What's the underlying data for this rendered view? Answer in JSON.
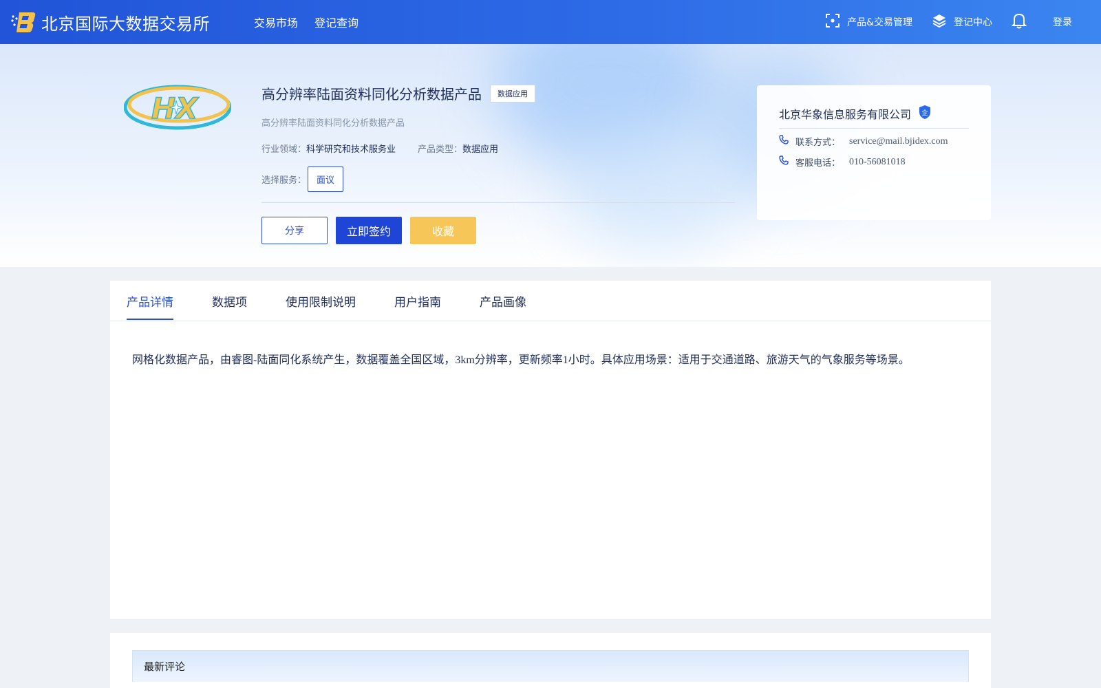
{
  "header": {
    "site_title": "北京国际大数据交易所",
    "nav": [
      "交易市场",
      "登记查询"
    ],
    "product_mgmt": "产品&交易管理",
    "register_center": "登记中心",
    "login": "登录"
  },
  "product": {
    "title": "高分辨率陆面资料同化分析数据产品",
    "tag": "数据应用",
    "subtitle": "高分辨率陆面资料同化分析数据产品",
    "industry_label": "行业领域：",
    "industry_value": "科学研究和技术服务业",
    "type_label": "产品类型：",
    "type_value": "数据应用",
    "service_label": "选择服务：",
    "service_option": "面议",
    "actions": {
      "share": "分享",
      "sign": "立即签约",
      "favorite": "收藏"
    }
  },
  "company": {
    "name": "北京华象信息服务有限公司",
    "badge": "企",
    "contact_label": "联系方式：",
    "contact_value": "service@mail.bjidex.com",
    "phone_label": "客服电话：",
    "phone_value": "010-56081018"
  },
  "tabs": [
    "产品详情",
    "数据项",
    "使用限制说明",
    "用户指南",
    "产品画像"
  ],
  "active_tab": 0,
  "detail_text": "网格化数据产品，由睿图-陆面同化系统产生，数据覆盖全国区域，3km分辨率，更新频率1小时。具体应用场景：适用于交通道路、旅游天气的气象服务等场景。",
  "comments": {
    "title": "最新评论"
  },
  "colors": {
    "primary": "#1f45d6",
    "accent_yellow": "#f6c659",
    "header_start": "#2154d8",
    "header_end": "#3b86f0"
  }
}
